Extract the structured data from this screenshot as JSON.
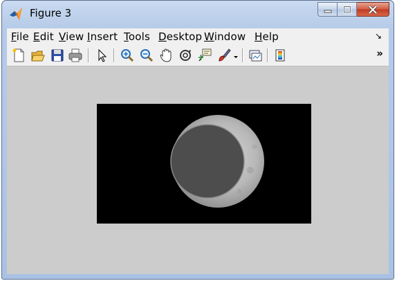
{
  "window": {
    "title": "Figure 3"
  },
  "menu": [
    {
      "accel": "F",
      "rest": "ile"
    },
    {
      "accel": "E",
      "rest": "dit"
    },
    {
      "accel": "V",
      "rest": "iew"
    },
    {
      "accel": "I",
      "rest": "nsert"
    },
    {
      "accel": "T",
      "rest": "ools"
    },
    {
      "accel": "D",
      "rest": "esktop"
    },
    {
      "accel": "W",
      "rest": "indow"
    },
    {
      "accel": "H",
      "rest": "elp"
    }
  ],
  "menu_arrow": "↘",
  "toolbar_chevron": "»",
  "toolbar_icons": [
    "new-figure-icon",
    "open-file-icon",
    "save-icon",
    "print-icon",
    "pointer-icon",
    "zoom-in-icon",
    "zoom-out-icon",
    "pan-hand-icon",
    "rotate-3d-icon",
    "data-cursor-icon",
    "brush-icon",
    "brush-dropdown-icon",
    "link-plot-icon",
    "colorbar-icon"
  ],
  "colors": {
    "figure_bg": "#cccccc",
    "axes_bg": "#000000",
    "disc_dark": "#4d4d4d"
  }
}
